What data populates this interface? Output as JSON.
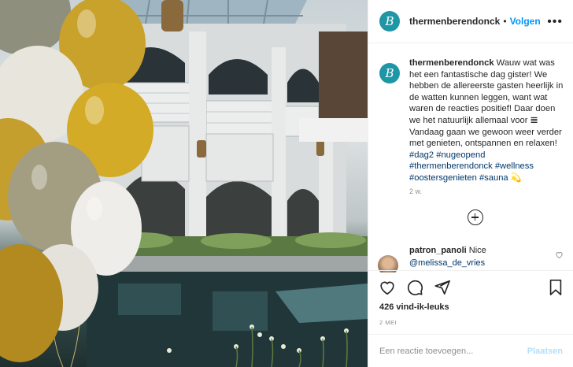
{
  "colors": {
    "accent": "#0095f6",
    "brand": "#1e96a6",
    "link": "#00376b",
    "muted": "#8e8e8e"
  },
  "header": {
    "username": "thermenberendonck",
    "separator": "•",
    "follow_label": "Volgen",
    "more_icon": "more-horizontal-icon"
  },
  "logo": {
    "letter": "B"
  },
  "caption": {
    "username": "thermenberendonck",
    "text": "Wauw wat was het een fantastische dag gister! We hebben de allereerste gasten heerlijk in de watten kunnen leggen, want wat waren de reacties positief! Daar doen we het natuurlijk allemaal voor 𝌆 Vandaag gaan we gewoon weer verder met genieten, ontspannen en relaxen!",
    "hashtags": "#dag2 #nugeopend #thermenberendonck #wellness #oostersgenieten #sauna",
    "emoji": "💫",
    "time": "2 w."
  },
  "comment": {
    "username": "patron_panoli",
    "text": "Nice",
    "mention": "@melissa_de_vries"
  },
  "actions": {
    "like_icon": "heart-icon",
    "comment_icon": "comment-icon",
    "share_icon": "share-icon",
    "save_icon": "bookmark-icon"
  },
  "likes": "426 vind-ik-leuks",
  "date": "2 MEI",
  "comment_box": {
    "placeholder": "Een reactie toevoegen...",
    "post_label": "Plaatsen"
  }
}
